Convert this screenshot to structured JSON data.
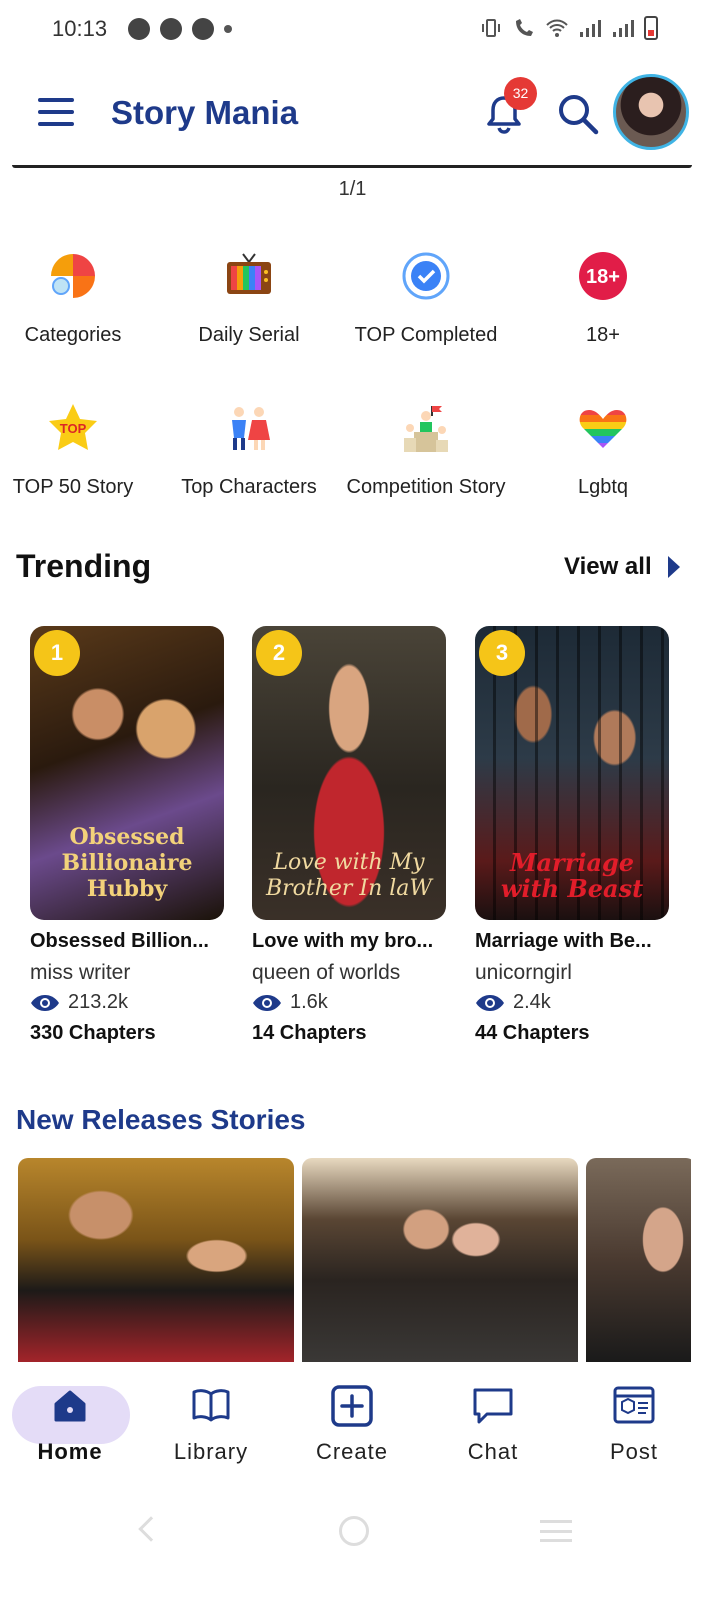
{
  "status_bar": {
    "time": "10:13",
    "icons": [
      "whatsapp-icon",
      "chat-bubble-icon",
      "play-icon",
      "vibrate-icon",
      "volte-call-icon",
      "wifi-icon",
      "signal-icon",
      "signal-icon",
      "battery-icon"
    ]
  },
  "header": {
    "title": "Story Mania",
    "notification_count": "32"
  },
  "pager": "1/1",
  "categories": [
    {
      "label": "Categories",
      "icon": "categories-icon"
    },
    {
      "label": "Daily Serial",
      "icon": "tv-icon"
    },
    {
      "label": "TOP Completed",
      "icon": "check-badge-icon"
    },
    {
      "label": "18+",
      "icon": "adult-badge-icon",
      "badge": "18+"
    },
    {
      "label": "TOP 50 Story",
      "icon": "top-star-icon",
      "badge": "TOP"
    },
    {
      "label": "Top Characters",
      "icon": "characters-icon"
    },
    {
      "label": "Competition Story",
      "icon": "competition-icon"
    },
    {
      "label": "Lgbtq",
      "icon": "rainbow-heart-icon"
    }
  ],
  "trending": {
    "title": "Trending",
    "view_all": "View all",
    "books": [
      {
        "rank": "1",
        "title": "Obsessed Billion...",
        "cover_text": "Obsessed Billionaire Hubby",
        "author": "miss writer",
        "views": "213.2k",
        "chapters": "330 Chapters"
      },
      {
        "rank": "2",
        "title": "Love with my bro...",
        "cover_text": "Love with My Brother In laW",
        "author": "queen of worlds",
        "views": "1.6k",
        "chapters": "14 Chapters"
      },
      {
        "rank": "3",
        "title": "Marriage with Be...",
        "cover_text": "Marriage with Beast",
        "author": "unicorngirl",
        "views": "2.4k",
        "chapters": "44 Chapters"
      }
    ]
  },
  "new_releases": {
    "title": "New Releases Stories"
  },
  "bottom_nav": [
    {
      "label": "Home",
      "icon": "home-icon",
      "active": true
    },
    {
      "label": "Library",
      "icon": "book-icon"
    },
    {
      "label": "Create",
      "icon": "plus-square-icon"
    },
    {
      "label": "Chat",
      "icon": "chat-icon"
    },
    {
      "label": "Post",
      "icon": "post-icon"
    }
  ],
  "colors": {
    "brand": "#1e3a8a",
    "badge": "#e53935",
    "rank": "#f5c518",
    "active_pill": "#e4dcf7"
  }
}
